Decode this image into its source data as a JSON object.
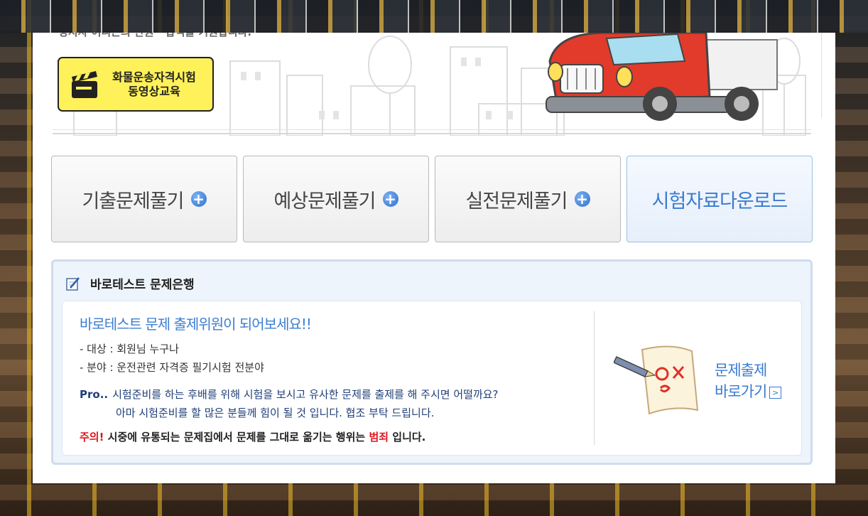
{
  "header": {
    "truncated_text": "정지자 어디든의 안원 · 합격을 기원합니다.",
    "video_button": {
      "line1": "화물운송자격시험",
      "line2": "동영상교육"
    }
  },
  "tabs": [
    {
      "label": "기출문제풀기",
      "has_plus": true
    },
    {
      "label": "예상문제풀기",
      "has_plus": true
    },
    {
      "label": "실전문제풀기",
      "has_plus": true
    },
    {
      "label": "시험자료다운로드",
      "has_plus": false
    }
  ],
  "question_bank": {
    "title": "바로테스트 문제은행",
    "headline": "바로테스트 문제 출제위원이 되어보세요!!",
    "target": "- 대상 : 회원님 누구나",
    "field": "- 분야 : 운전관련 자격증 필기시험 전분야",
    "pro_label": "Pro..",
    "pro_text1": "시험준비를 하는 후배를 위해 시험을 보시고 유사한 문제를 출제를 해 주시면 어떨까요?",
    "pro_text2": "아마 시험준비를 할 많은 분들께 힘이 될 것 입니다. 협조 부탁 드립니다.",
    "warn_label": "주의!",
    "warn_text1": " 시중에 유통되는 문제집에서 문제를 그대로 옮기는 행위는 ",
    "warn_crime": "범죄",
    "warn_text2": " 입니다.",
    "goto_line1": "문제출제",
    "goto_line2": "바로가기",
    "goto_arrow": ">"
  },
  "colors": {
    "accent_blue": "#3a7bd0",
    "warning_red": "#e0161d",
    "button_yellow": "#fff15a"
  }
}
